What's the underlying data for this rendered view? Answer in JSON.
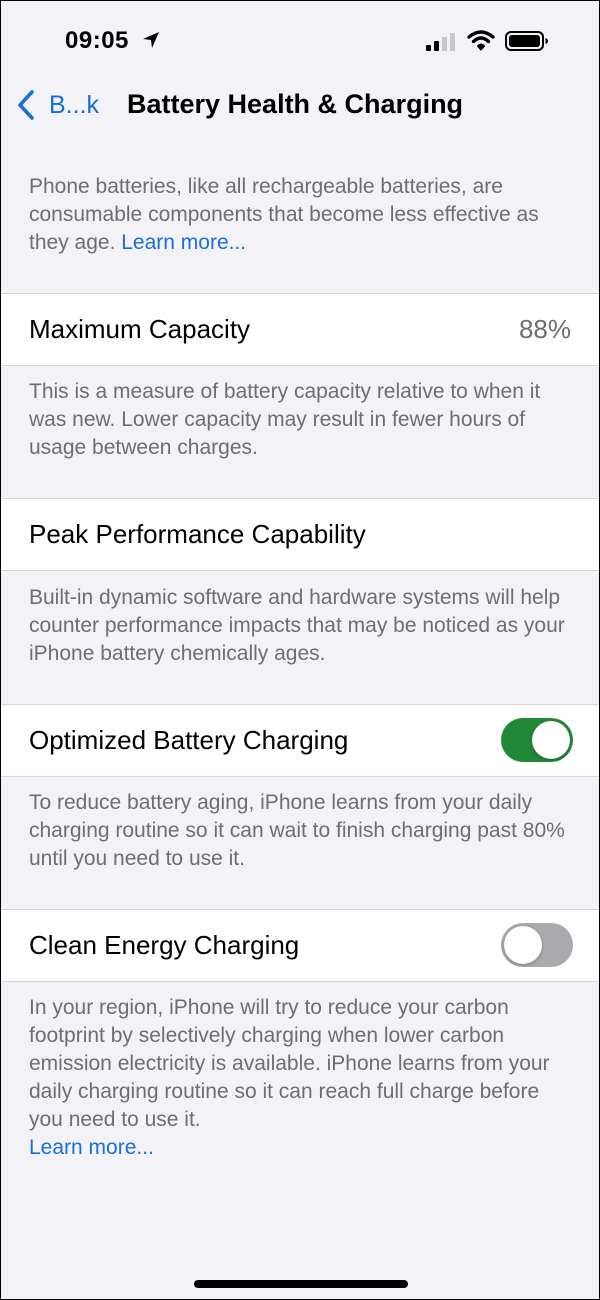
{
  "status_bar": {
    "time": "09:05",
    "location_icon": "location-arrow-icon",
    "signal_icon": "cellular-signal-icon",
    "wifi_icon": "wifi-icon",
    "battery_icon": "battery-icon"
  },
  "nav": {
    "back_label": "B...k",
    "title": "Battery Health & Charging"
  },
  "intro": {
    "text": "Phone batteries, like all rechargeable batteries, are consumable components that become less effective as they age. ",
    "link": "Learn more..."
  },
  "maximum_capacity": {
    "label": "Maximum Capacity",
    "value": "88%",
    "description": "This is a measure of battery capacity relative to when it was new. Lower capacity may result in fewer hours of usage between charges."
  },
  "peak_performance": {
    "label": "Peak Performance Capability",
    "description": "Built-in dynamic software and hardware systems will help counter performance impacts that may be noticed as your iPhone battery chemically ages."
  },
  "optimized_charging": {
    "label": "Optimized Battery Charging",
    "enabled": true,
    "description": "To reduce battery aging, iPhone learns from your daily charging routine so it can wait to finish charging past 80% until you need to use it."
  },
  "clean_energy": {
    "label": "Clean Energy Charging",
    "enabled": false,
    "description": "In your region, iPhone will try to reduce your carbon footprint by selectively charging when lower carbon emission electricity is available. iPhone learns from your daily charging routine so it can reach full charge before you need to use it.",
    "link": "Learn more..."
  },
  "colors": {
    "accent": "#1a6fd6",
    "toggle_on": "#218838",
    "toggle_off": "#a9a9ae",
    "background": "#f2f2f7",
    "secondary_text": "#6d6d72"
  }
}
